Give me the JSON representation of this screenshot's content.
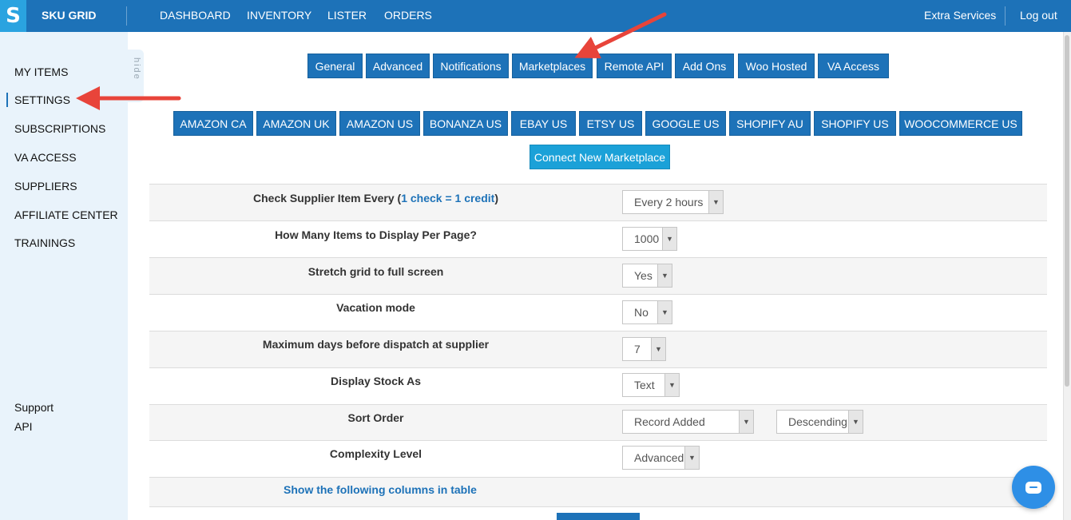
{
  "header": {
    "logo_glyph": "S",
    "brand": "SKU GRID",
    "nav": [
      "DASHBOARD",
      "INVENTORY",
      "LISTER",
      "ORDERS"
    ],
    "extra_services": "Extra Services",
    "logout": "Log out"
  },
  "sidebar": {
    "items": [
      "MY ITEMS",
      "SETTINGS",
      "SUBSCRIPTIONS",
      "VA ACCESS",
      "SUPPLIERS",
      "AFFILIATE CENTER",
      "TRAININGS"
    ],
    "active": "SETTINGS",
    "hide_label": "hide",
    "bottom_links": [
      "Support",
      "API"
    ]
  },
  "settings_tabs": [
    "General",
    "Advanced",
    "Notifications",
    "Marketplaces",
    "Remote API",
    "Add Ons",
    "Woo Hosted",
    "VA Access"
  ],
  "marketplaces": [
    "AMAZON CA",
    "AMAZON UK",
    "AMAZON US",
    "BONANZA US",
    "EBAY US",
    "ETSY US",
    "GOOGLE US",
    "SHOPIFY AU",
    "SHOPIFY US",
    "WOOCOMMERCE US"
  ],
  "connect_button": "Connect New Marketplace",
  "settings": {
    "check_supplier": {
      "label": "Check Supplier Item Every (",
      "link": "1 check = 1 credit",
      "suffix": ")",
      "value": "Every 2 hours"
    },
    "items_per_page": {
      "label": "How Many Items to Display Per Page?",
      "value": "1000"
    },
    "stretch_grid": {
      "label": "Stretch grid to full screen",
      "value": "Yes"
    },
    "vacation_mode": {
      "label": "Vacation mode",
      "value": "No"
    },
    "max_days": {
      "label": "Maximum days before dispatch at supplier",
      "value": "7"
    },
    "display_stock": {
      "label": "Display Stock As",
      "value": "Text"
    },
    "sort_order": {
      "label": "Sort Order",
      "value": "Record Added",
      "direction": "Descending"
    },
    "complexity": {
      "label": "Complexity Level",
      "value": "Advanced"
    },
    "show_columns": "Show the following columns in table"
  },
  "colors": {
    "header_blue": "#1d72b8",
    "logo_blue": "#2aa3e0",
    "sidebar_bg": "#e9f3fb",
    "connect_button": "#1ba1d8",
    "annotation_arrow": "#e8443a"
  },
  "icons": {
    "select_arrow": "chevron-down-icon",
    "chat": "chat-bubble-icon",
    "logo": "dollar-s-icon"
  }
}
